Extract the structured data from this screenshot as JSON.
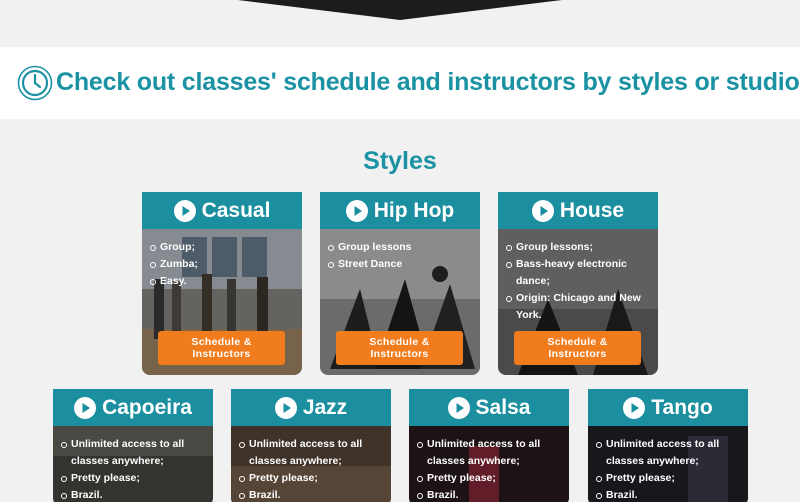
{
  "banner": {
    "heading": "Check out classes' schedule and instructors by styles or studios!",
    "icon": "clock-icon",
    "accent": "#1a92a3"
  },
  "styles_section": {
    "title": "Styles"
  },
  "cta_color": "#f07c1d",
  "header_color": "#1b8f9f",
  "cards": [
    {
      "name": "Casual",
      "items": [
        "Group;",
        "Zumba;",
        "Easy."
      ],
      "cta_line1": "Schedule &",
      "cta_line2": "Instructors"
    },
    {
      "name": "Hip Hop",
      "items": [
        "Group lessons",
        "Street Dance"
      ],
      "cta_line1": "Schedule &",
      "cta_line2": "Instructors"
    },
    {
      "name": "House",
      "items": [
        "Group lessons;",
        "Bass-heavy electronic dance;",
        "Origin: Chicago and New York."
      ],
      "cta_line1": "Schedule &",
      "cta_line2": "Instructors"
    },
    {
      "name": "Capoeira",
      "items": [
        "Unlimited access to all classes anywhere;",
        "Pretty please;",
        "Brazil."
      ]
    },
    {
      "name": "Jazz",
      "items": [
        "Unlimited access to all classes anywhere;",
        "Pretty please;",
        "Brazil."
      ]
    },
    {
      "name": "Salsa",
      "items": [
        "Unlimited access to all classes anywhere;",
        "Pretty please;",
        "Brazil."
      ]
    },
    {
      "name": "Tango",
      "items": [
        "Unlimited access to all classes anywhere;",
        "Pretty please;",
        "Brazil."
      ]
    }
  ]
}
